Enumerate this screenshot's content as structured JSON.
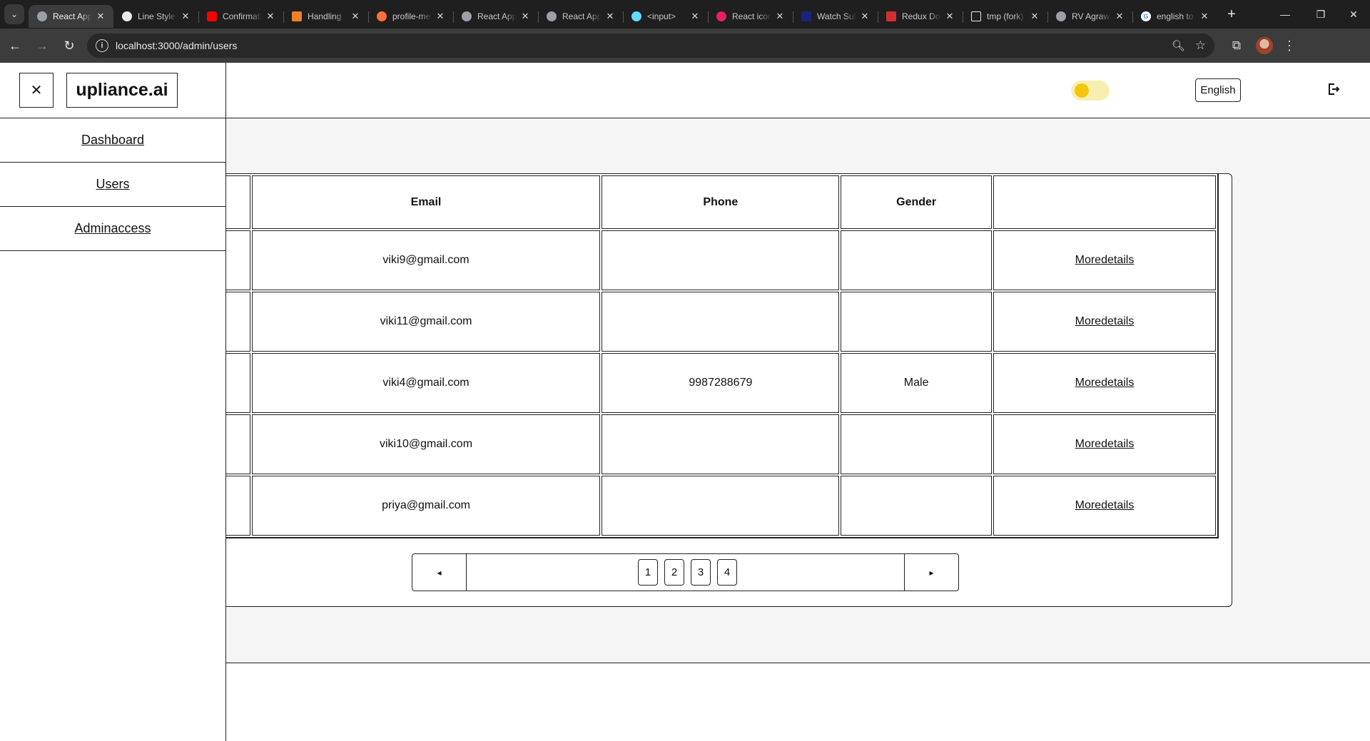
{
  "browser": {
    "tabs": [
      {
        "label": "React App",
        "favicon_color": "#9aa0a6",
        "favicon": "globe-icon",
        "active": true
      },
      {
        "label": "Line Styles",
        "favicon_color": "#e8eaed",
        "favicon": "shield-icon"
      },
      {
        "label": "Confirmation",
        "favicon_color": "#ff0000",
        "favicon": "youtube-icon"
      },
      {
        "label": "Handling",
        "favicon_color": "#f48024",
        "favicon": "stackoverflow-icon"
      },
      {
        "label": "profile-menu",
        "favicon_color": "#ff7139",
        "favicon": "firebase-icon"
      },
      {
        "label": "React App",
        "favicon_color": "#9aa0a6",
        "favicon": "globe-icon"
      },
      {
        "label": "React App",
        "favicon_color": "#9aa0a6",
        "favicon": "globe-icon"
      },
      {
        "label": "<input>",
        "favicon_color": "#61dafb",
        "favicon": "react-icon"
      },
      {
        "label": "React icons",
        "favicon_color": "#e91e63",
        "favicon": "react-icons-icon"
      },
      {
        "label": "Watch Sub",
        "favicon_color": "#1a237e",
        "favicon": "video-icon"
      },
      {
        "label": "Redux Docs",
        "favicon_color": "#d32f2f",
        "favicon": "gmail-icon"
      },
      {
        "label": "tmp (fork)",
        "favicon_color": "#e8eaed",
        "favicon": "square-icon"
      },
      {
        "label": "RV Agrawal",
        "favicon_color": "#9aa0a6",
        "favicon": "globe-icon"
      },
      {
        "label": "english to",
        "favicon_color": "#4285f4",
        "favicon": "google-icon"
      }
    ],
    "url": "localhost:3000/admin/users"
  },
  "sidebar": {
    "close_symbol": "✕",
    "brand": "upliance.ai",
    "items": [
      {
        "label": "Dashboard"
      },
      {
        "label": "Users"
      },
      {
        "label": "Adminaccess"
      }
    ]
  },
  "header": {
    "language": "English",
    "theme_toggle_on": true,
    "toggle_color": "#f4c70f"
  },
  "users_table": {
    "columns": [
      "Email",
      "Phone",
      "Gender",
      ""
    ],
    "action_label": "Moredetails",
    "rows": [
      {
        "email": "viki9@gmail.com",
        "phone": "",
        "gender": ""
      },
      {
        "email": "viki11@gmail.com",
        "phone": "",
        "gender": ""
      },
      {
        "email": "viki4@gmail.com",
        "phone": "9987288679",
        "gender": "Male"
      },
      {
        "email": "viki10@gmail.com",
        "phone": "",
        "gender": ""
      },
      {
        "email": "priya@gmail.com",
        "phone": "",
        "gender": ""
      }
    ]
  },
  "pagination": {
    "prev": "◂",
    "next": "▸",
    "pages": [
      "1",
      "2",
      "3",
      "4"
    ]
  }
}
